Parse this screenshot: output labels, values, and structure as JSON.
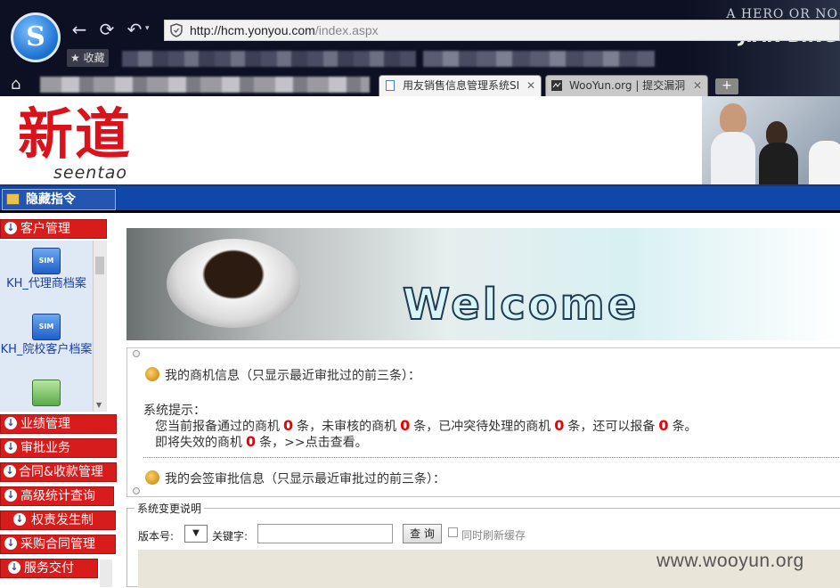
{
  "browser": {
    "banner_line1": "A HERO OR NO",
    "banner_line2": "JIAN BING",
    "url_host": "http://hcm.yonyou.com",
    "url_path": "/index.aspx",
    "favorites_label": "★ 收藏",
    "tabs": [
      {
        "label": "用友销售信息管理系统SI"
      },
      {
        "label": "WooYun.org | 提交漏洞"
      }
    ],
    "newtab": "+"
  },
  "header": {
    "brand_cn": "新道",
    "brand_en": "seentao"
  },
  "toolbar": {
    "hide_cmd": "隐藏指令"
  },
  "sidebar": {
    "customer_mgmt": "客户管理",
    "customer_items": [
      {
        "label": "KH_代理商档案",
        "icon": "SIM"
      },
      {
        "label": "KH_院校客户档案",
        "icon": "SIM"
      },
      {
        "label": "",
        "icon": ""
      }
    ],
    "menus": [
      "业绩管理",
      "审批业务",
      "合同&收款管理",
      "高级统计查询",
      "权责发生制",
      "采购合同管理",
      "服务交付"
    ]
  },
  "main": {
    "welcome": "Welcome",
    "opportunity_title": "我的商机信息（只显示最近审批过的前三条）：",
    "sys_tip": "系统提示：",
    "tip_a": "您当前报备通过的商机",
    "tip_b": "条，未审核的商机",
    "tip_c": "条，已冲突待处理的商机",
    "tip_d": "条，还可以报备",
    "tip_e": "条。",
    "count_passed": "0",
    "count_unreviewed": "0",
    "count_conflict": "0",
    "count_remaining": "0",
    "expire_a": "即将失效的商机",
    "count_expiring": "0",
    "expire_b": "条，>>点击查看。",
    "countersign_title": "我的会签审批信息（只显示最近审批过的前三条）："
  },
  "change_log": {
    "legend": "系统变更说明",
    "version_label": "版本号:",
    "version_value": "▼",
    "keyword_label": "关键字:",
    "keyword_value": "",
    "query_button": "查 询",
    "refresh_label": "同时刷新缓存"
  },
  "watermark": "www.wooyun.org"
}
